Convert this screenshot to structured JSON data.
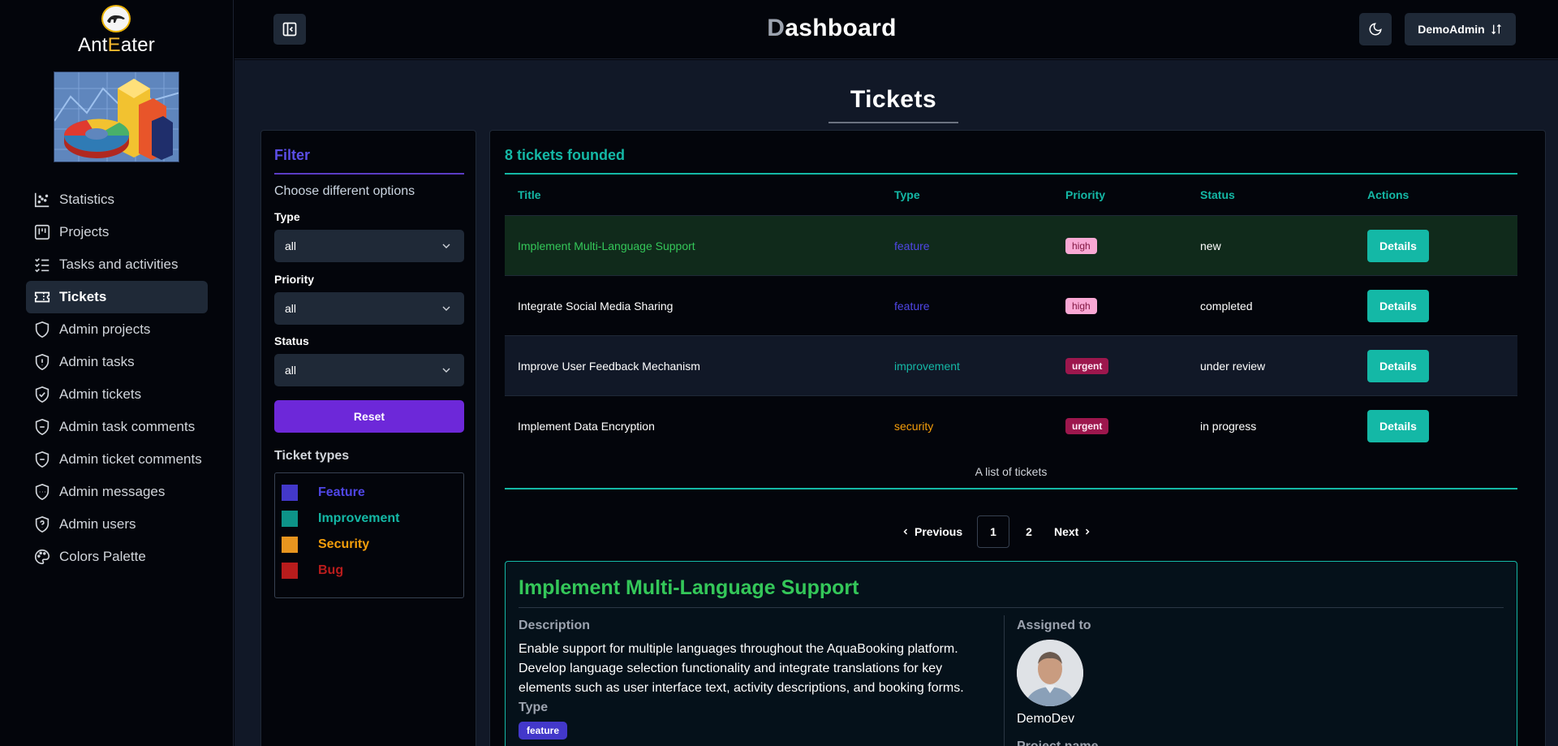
{
  "app": {
    "name_prefix": "Ant",
    "name_e": "E",
    "name_suffix": "ater"
  },
  "sidebar": {
    "items": [
      {
        "label": "Statistics",
        "icon": "chart-scatter-icon"
      },
      {
        "label": "Projects",
        "icon": "kanban-icon"
      },
      {
        "label": "Tasks and activities",
        "icon": "checklist-icon"
      },
      {
        "label": "Tickets",
        "icon": "ticket-icon",
        "active": true
      },
      {
        "label": "Admin projects",
        "icon": "shield-icon"
      },
      {
        "label": "Admin tasks",
        "icon": "shield-alert-icon"
      },
      {
        "label": "Admin tickets",
        "icon": "shield-check-icon"
      },
      {
        "label": "Admin task comments",
        "icon": "shield-minus-icon"
      },
      {
        "label": "Admin ticket comments",
        "icon": "shield-minus-icon"
      },
      {
        "label": "Admin messages",
        "icon": "shield-dots-icon"
      },
      {
        "label": "Admin users",
        "icon": "shield-question-icon"
      },
      {
        "label": "Colors Palette",
        "icon": "palette-icon"
      }
    ]
  },
  "header": {
    "title_first": "D",
    "title_rest": "ashboard",
    "user": "DemoAdmin"
  },
  "page": {
    "title": "Tickets"
  },
  "filter": {
    "title": "Filter",
    "subtitle": "Choose different options",
    "type_label": "Type",
    "type_value": "all",
    "priority_label": "Priority",
    "priority_value": "all",
    "status_label": "Status",
    "status_value": "all",
    "reset": "Reset",
    "types_title": "Ticket types",
    "types": [
      {
        "label": "Feature",
        "color": "#4338ca"
      },
      {
        "label": "Improvement",
        "color": "#14b8a6"
      },
      {
        "label": "Security",
        "color": "#f59e0b"
      },
      {
        "label": "Bug",
        "color": "#b91c1c"
      }
    ]
  },
  "tickets": {
    "found": "8 tickets founded",
    "columns": [
      "Title",
      "Type",
      "Priority",
      "Status",
      "Actions"
    ],
    "rows": [
      {
        "title": "Implement Multi-Language Support",
        "type": "feature",
        "priority": "high",
        "status": "new",
        "action": "Details"
      },
      {
        "title": "Integrate Social Media Sharing",
        "type": "feature",
        "priority": "high",
        "status": "completed",
        "action": "Details"
      },
      {
        "title": "Improve User Feedback Mechanism",
        "type": "improvement",
        "priority": "urgent",
        "status": "under review",
        "action": "Details"
      },
      {
        "title": "Implement Data Encryption",
        "type": "security",
        "priority": "urgent",
        "status": "in progress",
        "action": "Details"
      }
    ],
    "caption": "A list of tickets"
  },
  "pagination": {
    "previous": "Previous",
    "pages": [
      "1",
      "2"
    ],
    "current": "1",
    "next": "Next"
  },
  "detail": {
    "title": "Implement Multi-Language Support",
    "description_label": "Description",
    "description": "Enable support for multiple languages throughout the AquaBooking platform. Develop language selection functionality and integrate translations for key elements such as user interface text, activity descriptions, and booking forms.",
    "type_label": "Type",
    "type_value": "feature",
    "assigned_label": "Assigned to",
    "assigned_user": "DemoDev",
    "project_label": "Project name"
  }
}
